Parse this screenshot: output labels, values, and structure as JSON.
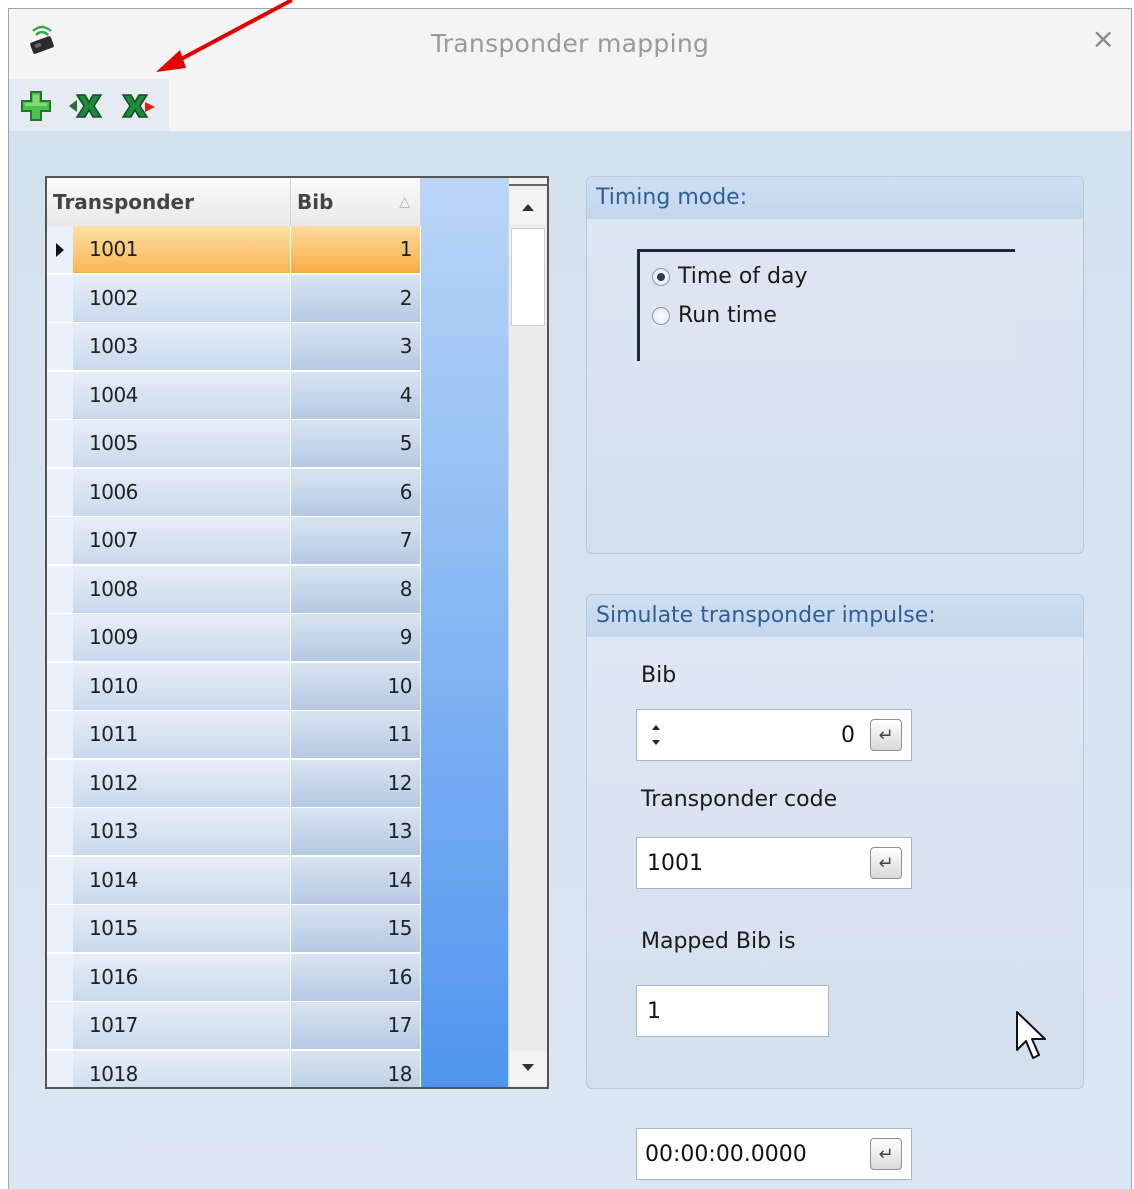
{
  "window": {
    "title": "Transponder mapping",
    "close_glyph": "×"
  },
  "toolbar": {
    "buttons": [
      {
        "icon": "add-plus-icon"
      },
      {
        "icon": "excel-import-icon"
      },
      {
        "icon": "excel-export-icon"
      }
    ]
  },
  "grid": {
    "columns": [
      "Transponder",
      "Bib"
    ],
    "sort_indicator": "△",
    "selected_row": 0,
    "rows": [
      {
        "transponder": "1001",
        "bib": "1"
      },
      {
        "transponder": "1002",
        "bib": "2"
      },
      {
        "transponder": "1003",
        "bib": "3"
      },
      {
        "transponder": "1004",
        "bib": "4"
      },
      {
        "transponder": "1005",
        "bib": "5"
      },
      {
        "transponder": "1006",
        "bib": "6"
      },
      {
        "transponder": "1007",
        "bib": "7"
      },
      {
        "transponder": "1008",
        "bib": "8"
      },
      {
        "transponder": "1009",
        "bib": "9"
      },
      {
        "transponder": "1010",
        "bib": "10"
      },
      {
        "transponder": "1011",
        "bib": "11"
      },
      {
        "transponder": "1012",
        "bib": "12"
      },
      {
        "transponder": "1013",
        "bib": "13"
      },
      {
        "transponder": "1014",
        "bib": "14"
      },
      {
        "transponder": "1015",
        "bib": "15"
      },
      {
        "transponder": "1016",
        "bib": "16"
      },
      {
        "transponder": "1017",
        "bib": "17"
      },
      {
        "transponder": "1018",
        "bib": "18"
      }
    ]
  },
  "timing_mode": {
    "title": "Timing mode:",
    "options": [
      {
        "label": "Time of day",
        "checked": true
      },
      {
        "label": "Run time",
        "checked": false
      }
    ]
  },
  "simulate": {
    "title": "Simulate transponder impulse:",
    "bib_label": "Bib",
    "bib_value": "0",
    "transponder_code_label": "Transponder code",
    "transponder_code_value": "1001",
    "mapped_bib_label": "Mapped Bib is",
    "mapped_bib_value": "1"
  },
  "time_input": {
    "value": "00:00:00.0000"
  },
  "enter_glyph": "↵",
  "colors": {
    "selected_row": "#fbb452",
    "group_title_text": "#2e5f9a",
    "annotation_arrow": "#e00000"
  }
}
